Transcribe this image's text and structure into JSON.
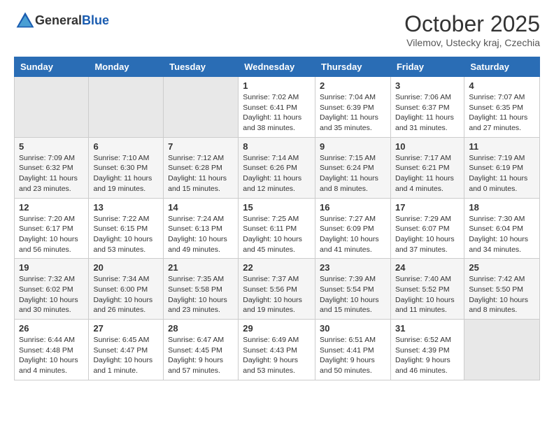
{
  "logo": {
    "general": "General",
    "blue": "Blue"
  },
  "header": {
    "month": "October 2025",
    "location": "Vilemov, Ustecky kraj, Czechia"
  },
  "weekdays": [
    "Sunday",
    "Monday",
    "Tuesday",
    "Wednesday",
    "Thursday",
    "Friday",
    "Saturday"
  ],
  "weeks": [
    [
      {
        "day": "",
        "info": ""
      },
      {
        "day": "",
        "info": ""
      },
      {
        "day": "",
        "info": ""
      },
      {
        "day": "1",
        "info": "Sunrise: 7:02 AM\nSunset: 6:41 PM\nDaylight: 11 hours\nand 38 minutes."
      },
      {
        "day": "2",
        "info": "Sunrise: 7:04 AM\nSunset: 6:39 PM\nDaylight: 11 hours\nand 35 minutes."
      },
      {
        "day": "3",
        "info": "Sunrise: 7:06 AM\nSunset: 6:37 PM\nDaylight: 11 hours\nand 31 minutes."
      },
      {
        "day": "4",
        "info": "Sunrise: 7:07 AM\nSunset: 6:35 PM\nDaylight: 11 hours\nand 27 minutes."
      }
    ],
    [
      {
        "day": "5",
        "info": "Sunrise: 7:09 AM\nSunset: 6:32 PM\nDaylight: 11 hours\nand 23 minutes."
      },
      {
        "day": "6",
        "info": "Sunrise: 7:10 AM\nSunset: 6:30 PM\nDaylight: 11 hours\nand 19 minutes."
      },
      {
        "day": "7",
        "info": "Sunrise: 7:12 AM\nSunset: 6:28 PM\nDaylight: 11 hours\nand 15 minutes."
      },
      {
        "day": "8",
        "info": "Sunrise: 7:14 AM\nSunset: 6:26 PM\nDaylight: 11 hours\nand 12 minutes."
      },
      {
        "day": "9",
        "info": "Sunrise: 7:15 AM\nSunset: 6:24 PM\nDaylight: 11 hours\nand 8 minutes."
      },
      {
        "day": "10",
        "info": "Sunrise: 7:17 AM\nSunset: 6:21 PM\nDaylight: 11 hours\nand 4 minutes."
      },
      {
        "day": "11",
        "info": "Sunrise: 7:19 AM\nSunset: 6:19 PM\nDaylight: 11 hours\nand 0 minutes."
      }
    ],
    [
      {
        "day": "12",
        "info": "Sunrise: 7:20 AM\nSunset: 6:17 PM\nDaylight: 10 hours\nand 56 minutes."
      },
      {
        "day": "13",
        "info": "Sunrise: 7:22 AM\nSunset: 6:15 PM\nDaylight: 10 hours\nand 53 minutes."
      },
      {
        "day": "14",
        "info": "Sunrise: 7:24 AM\nSunset: 6:13 PM\nDaylight: 10 hours\nand 49 minutes."
      },
      {
        "day": "15",
        "info": "Sunrise: 7:25 AM\nSunset: 6:11 PM\nDaylight: 10 hours\nand 45 minutes."
      },
      {
        "day": "16",
        "info": "Sunrise: 7:27 AM\nSunset: 6:09 PM\nDaylight: 10 hours\nand 41 minutes."
      },
      {
        "day": "17",
        "info": "Sunrise: 7:29 AM\nSunset: 6:07 PM\nDaylight: 10 hours\nand 37 minutes."
      },
      {
        "day": "18",
        "info": "Sunrise: 7:30 AM\nSunset: 6:04 PM\nDaylight: 10 hours\nand 34 minutes."
      }
    ],
    [
      {
        "day": "19",
        "info": "Sunrise: 7:32 AM\nSunset: 6:02 PM\nDaylight: 10 hours\nand 30 minutes."
      },
      {
        "day": "20",
        "info": "Sunrise: 7:34 AM\nSunset: 6:00 PM\nDaylight: 10 hours\nand 26 minutes."
      },
      {
        "day": "21",
        "info": "Sunrise: 7:35 AM\nSunset: 5:58 PM\nDaylight: 10 hours\nand 23 minutes."
      },
      {
        "day": "22",
        "info": "Sunrise: 7:37 AM\nSunset: 5:56 PM\nDaylight: 10 hours\nand 19 minutes."
      },
      {
        "day": "23",
        "info": "Sunrise: 7:39 AM\nSunset: 5:54 PM\nDaylight: 10 hours\nand 15 minutes."
      },
      {
        "day": "24",
        "info": "Sunrise: 7:40 AM\nSunset: 5:52 PM\nDaylight: 10 hours\nand 11 minutes."
      },
      {
        "day": "25",
        "info": "Sunrise: 7:42 AM\nSunset: 5:50 PM\nDaylight: 10 hours\nand 8 minutes."
      }
    ],
    [
      {
        "day": "26",
        "info": "Sunrise: 6:44 AM\nSunset: 4:48 PM\nDaylight: 10 hours\nand 4 minutes."
      },
      {
        "day": "27",
        "info": "Sunrise: 6:45 AM\nSunset: 4:47 PM\nDaylight: 10 hours\nand 1 minute."
      },
      {
        "day": "28",
        "info": "Sunrise: 6:47 AM\nSunset: 4:45 PM\nDaylight: 9 hours\nand 57 minutes."
      },
      {
        "day": "29",
        "info": "Sunrise: 6:49 AM\nSunset: 4:43 PM\nDaylight: 9 hours\nand 53 minutes."
      },
      {
        "day": "30",
        "info": "Sunrise: 6:51 AM\nSunset: 4:41 PM\nDaylight: 9 hours\nand 50 minutes."
      },
      {
        "day": "31",
        "info": "Sunrise: 6:52 AM\nSunset: 4:39 PM\nDaylight: 9 hours\nand 46 minutes."
      },
      {
        "day": "",
        "info": ""
      }
    ]
  ]
}
